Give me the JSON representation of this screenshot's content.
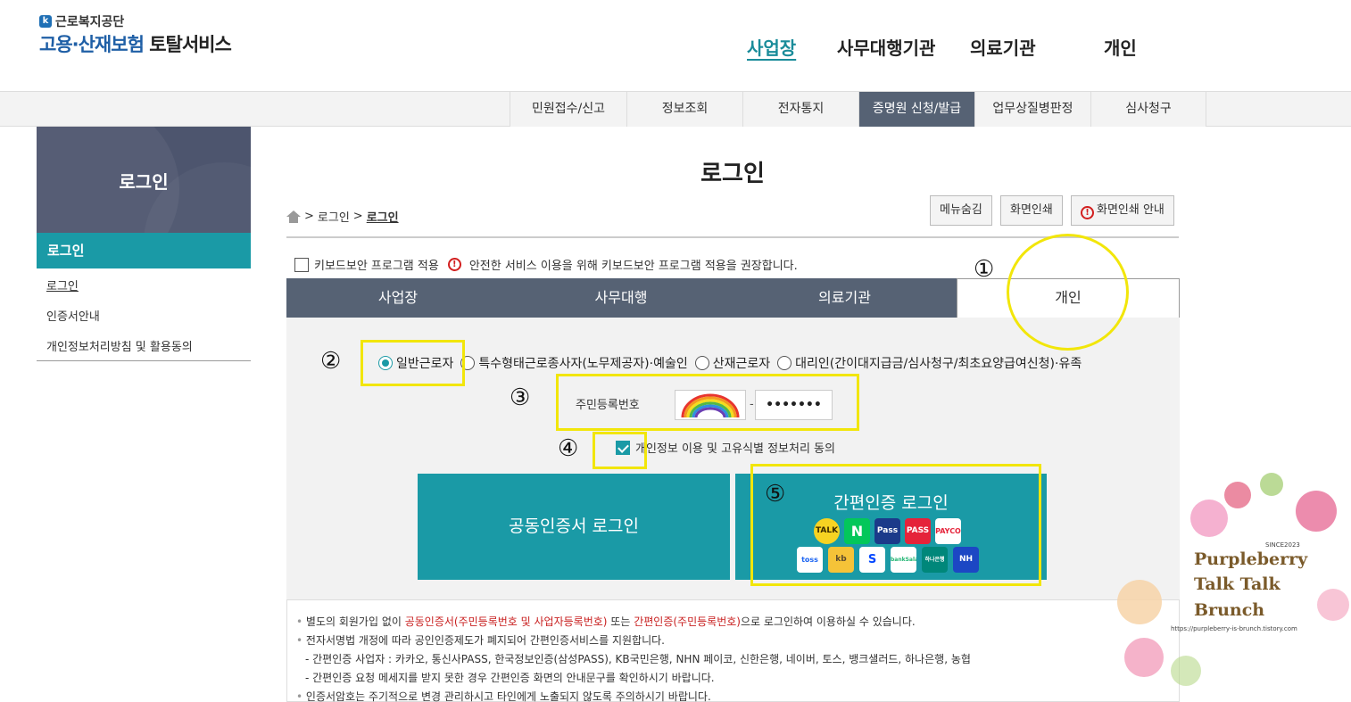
{
  "header": {
    "org": "근로복지공단",
    "logo_main": "고용·산재보험",
    "logo_sub": "토탈서비스",
    "gnb": [
      "사업장",
      "사무대행기관",
      "의료기관",
      "개인"
    ]
  },
  "subnav": [
    "민원접수/신고",
    "정보조회",
    "전자통지",
    "증명원 신청/발급",
    "업무상질병판정",
    "심사청구"
  ],
  "sidebar": {
    "title": "로그인",
    "active": "로그인",
    "links": [
      "로그인",
      "인증서안내",
      "개인정보처리방침 및 활용동의"
    ]
  },
  "main": {
    "title": "로그인",
    "breadcrumb": [
      "로그인",
      "로그인"
    ],
    "breadcrumb_sep": ">",
    "buttons": [
      "메뉴숨김",
      "화면인쇄",
      "화면인쇄 안내"
    ],
    "keyboard_security": {
      "label": "키보드보안 프로그램 적용",
      "notice": "안전한 서비스 이용을 위해 키보드보안 프로그램 적용을 권장합니다."
    },
    "login_tabs": [
      "사업장",
      "사무대행",
      "의료기관",
      "개인"
    ],
    "selected_tab": "개인",
    "radio_options": [
      "일반근로자",
      "특수형태근로종사자(노무제공자)·예술인",
      "산재근로자",
      "대리인(간이대지급금/심사청구/최초요양급여신청)·유족"
    ],
    "rrn_label": "주민등록번호",
    "rrn_dash": "-",
    "rrn_back_value": "•••••••",
    "agree_label": "개인정보 이용 및 고유식별 정보처리 동의",
    "cert_login_label": "공동인증서 로그인",
    "easy_login_label": "간편인증 로그인",
    "easy_providers_row1": [
      "TALK",
      "N",
      "Pass",
      "PASS",
      "PAYCO"
    ],
    "easy_providers_row2": [
      "toss",
      "kb",
      "S",
      "bankSalad",
      "하나은행",
      "NH"
    ],
    "notes": {
      "l1_a": "별도의 회원가입 없이 ",
      "l1_b": "공동인증서(주민등록번호 및 사업자등록번호)",
      "l1_c": " 또는 ",
      "l1_d": "간편인증(주민등록번호)",
      "l1_e": "으로 로그인하여 이용하실 수 있습니다.",
      "l2": "전자서명법 개정에 따라 공인인증제도가 폐지되어 간편인증서비스를 지원합니다.",
      "l3": "- 간편인증 사업자 : 카카오, 통신사PASS, 한국정보인증(삼성PASS), KB국민은행, NHN 페이코, 신한은행, 네이버, 토스, 뱅크샐러드, 하나은행, 농협",
      "l4": "- 간편인증 요청 메세지를 받지 못한 경우 간편인증 화면의 안내문구를 확인하시기 바랍니다.",
      "l5": "인증서암호는 주기적으로 변경 관리하시고 타인에게 노출되지 않도록 주의하시기 바랍니다."
    }
  },
  "annotations": [
    "①",
    "②",
    "③",
    "④",
    "⑤"
  ],
  "watermark": {
    "since": "SINCE2023",
    "line1": "Purpleberry",
    "line2": "Talk Talk",
    "line3": "Brunch",
    "url": "https://purpleberry-is-brunch.tistory.com"
  },
  "colors": {
    "teal": "#1a9aa6",
    "slate": "#566274",
    "annotation": "#f2e60a",
    "red": "#c81e1e"
  }
}
